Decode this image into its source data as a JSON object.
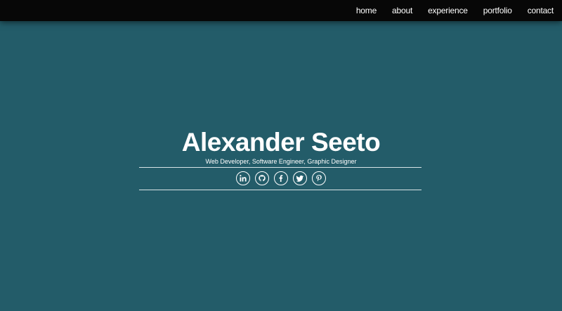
{
  "nav": {
    "items": [
      {
        "label": "home"
      },
      {
        "label": "about"
      },
      {
        "label": "experience"
      },
      {
        "label": "portfolio"
      },
      {
        "label": "contact"
      }
    ]
  },
  "hero": {
    "name": "Alexander Seeto",
    "tagline": "Web Developer, Software Engineer, Graphic Designer"
  },
  "social": {
    "icons": [
      "linkedin-icon",
      "github-icon",
      "facebook-icon",
      "twitter-icon",
      "pinterest-icon"
    ]
  },
  "colors": {
    "background": "#235c69",
    "navbar": "#070707",
    "text": "#ffffff"
  }
}
